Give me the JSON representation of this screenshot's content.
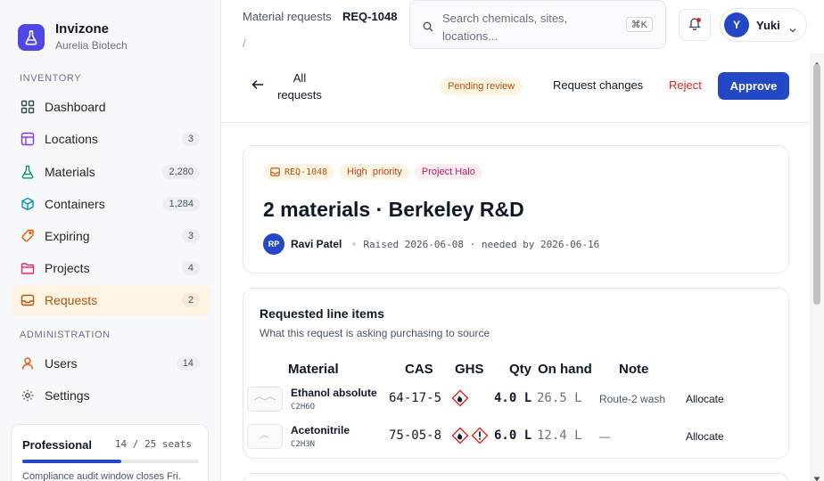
{
  "brand": {
    "name": "Invizone",
    "org": "Aurelia Biotech"
  },
  "sidebar": {
    "sections": [
      "INVENTORY",
      "ADMINISTRATION"
    ],
    "items": [
      {
        "label": "Dashboard",
        "count": ""
      },
      {
        "label": "Locations",
        "count": "3"
      },
      {
        "label": "Materials",
        "count": "2,280"
      },
      {
        "label": "Containers",
        "count": "1,284"
      },
      {
        "label": "Expiring",
        "count": "3"
      },
      {
        "label": "Projects",
        "count": "4"
      },
      {
        "label": "Requests",
        "count": "2"
      },
      {
        "label": "Users",
        "count": "14"
      },
      {
        "label": "Settings",
        "count": ""
      }
    ],
    "plan": {
      "name": "Professional",
      "seats": "14 / 25 seats",
      "seats_used": 14,
      "seats_total": 25,
      "note": "Compliance audit window closes Fri."
    }
  },
  "topbar": {
    "breadcrumb": "Material requests",
    "request_id": "REQ-1048",
    "separator": "/",
    "search_placeholder": "Search chemicals, sites, locations...",
    "shortcut": "⌘K",
    "user_initial": "Y",
    "user_name": "Yuki"
  },
  "actionbar": {
    "back_label": "All requests",
    "status": "Pending review",
    "request_changes": "Request changes",
    "reject": "Reject",
    "approve": "Approve"
  },
  "request": {
    "tags": {
      "id": "REQ-1048",
      "priority": "High  priority",
      "project": "Project Halo"
    },
    "title": "2 materials · Berkeley R&D",
    "requester_initials": "RP",
    "requester_name": "Ravi Patel",
    "dates": "Raised 2026-06-08 · needed by 2026-06-16"
  },
  "line_items": {
    "title": "Requested line items",
    "subtitle": "What this request is asking purchasing to source",
    "columns": [
      "Material",
      "CAS",
      "GHS",
      "Qty",
      "On hand",
      "Note"
    ],
    "rows": [
      {
        "name": "Ethanol absolute",
        "formula": "C2H6O",
        "cas": "64-17-5",
        "ghs": [
          "flame-icon"
        ],
        "qty": "4.0 L",
        "on_hand": "26.5 L",
        "note": "Route-2 wash",
        "action": "Allocate"
      },
      {
        "name": "Acetonitrile",
        "formula": "C2H3N",
        "cas": "75-05-8",
        "ghs": [
          "flame-icon",
          "exclamation-icon"
        ],
        "qty": "6.0 L",
        "on_hand": "12.4 L",
        "note": "—",
        "action": "Allocate"
      }
    ]
  },
  "colors": {
    "accent": "#2447c5",
    "brand": "#4f46e5",
    "active": "#b45309",
    "danger": "#dc2626"
  }
}
